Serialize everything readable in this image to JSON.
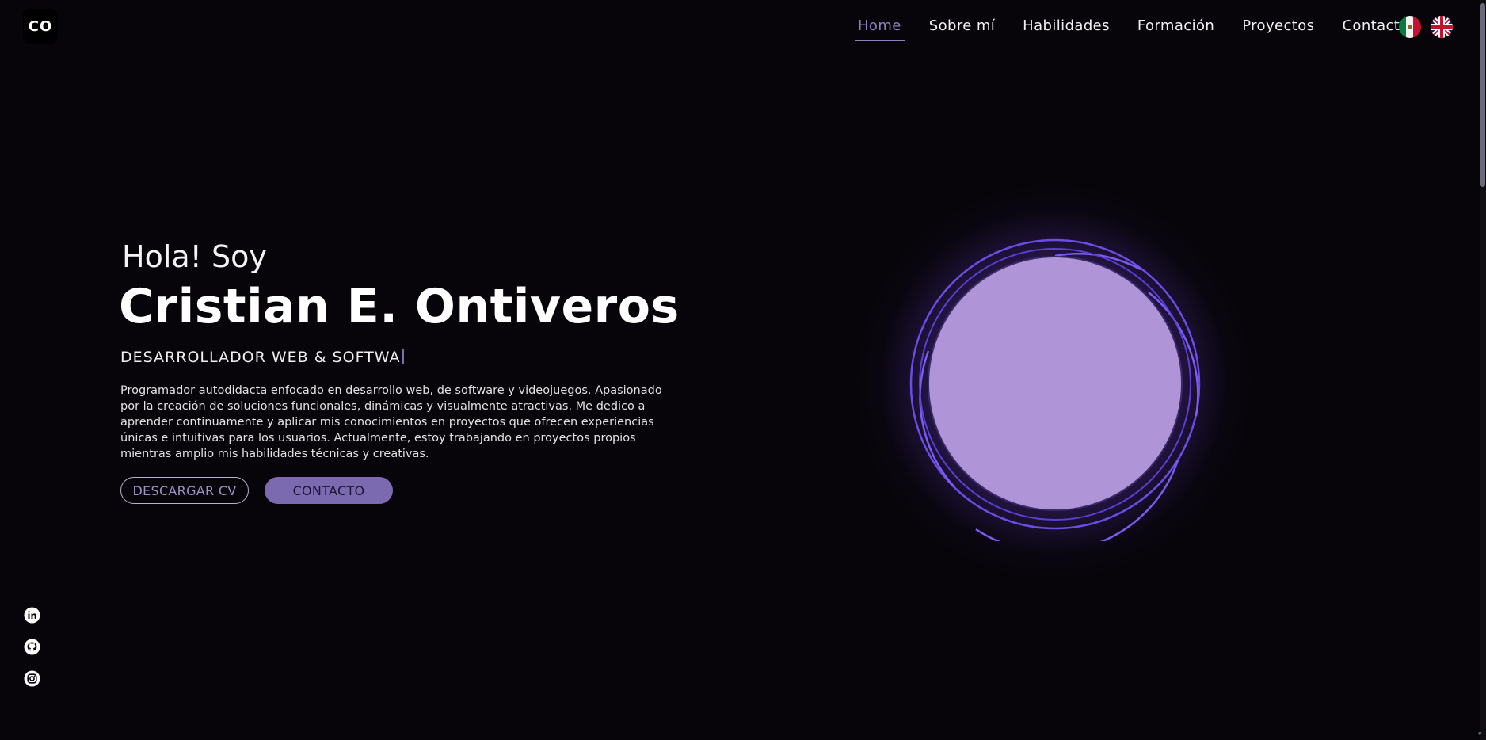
{
  "header": {
    "logo_text": "CO",
    "nav": [
      {
        "label": "Home",
        "active": true
      },
      {
        "label": "Sobre mí"
      },
      {
        "label": "Habilidades"
      },
      {
        "label": "Formación"
      },
      {
        "label": "Proyectos"
      },
      {
        "label": "Contacto"
      }
    ],
    "languages": [
      {
        "icon": "mexico-flag-icon"
      },
      {
        "icon": "uk-flag-icon"
      }
    ]
  },
  "hero": {
    "greeting": "Hola! Soy",
    "name": "Cristian E. Ontiveros",
    "role": "DESARROLLADOR WEB & SOFTWA",
    "description": "Programador autodidacta enfocado en desarrollo web, de software y videojuegos. Apasionado por la creación de soluciones funcionales, dinámicas y visualmente atractivas. Me dedico a aprender continuamente y aplicar mis conocimientos en proyectos que ofrecen experiencias únicas e intuitivas para los usuarios. Actualmente, estoy trabajando en proyectos propios mientras amplio mis habilidades técnicas y creativas.",
    "buttons": {
      "cv": "DESCARGAR CV",
      "contact": "CONTACTO"
    }
  },
  "social": [
    {
      "icon": "linkedin-icon"
    },
    {
      "icon": "github-icon"
    },
    {
      "icon": "instagram-icon"
    }
  ],
  "colors": {
    "background": "#07050a",
    "accent": "#7c6ab0",
    "nav_active": "#8b7fc0",
    "ring": "#6b4fe0",
    "photo_placeholder": "#b094d8"
  }
}
